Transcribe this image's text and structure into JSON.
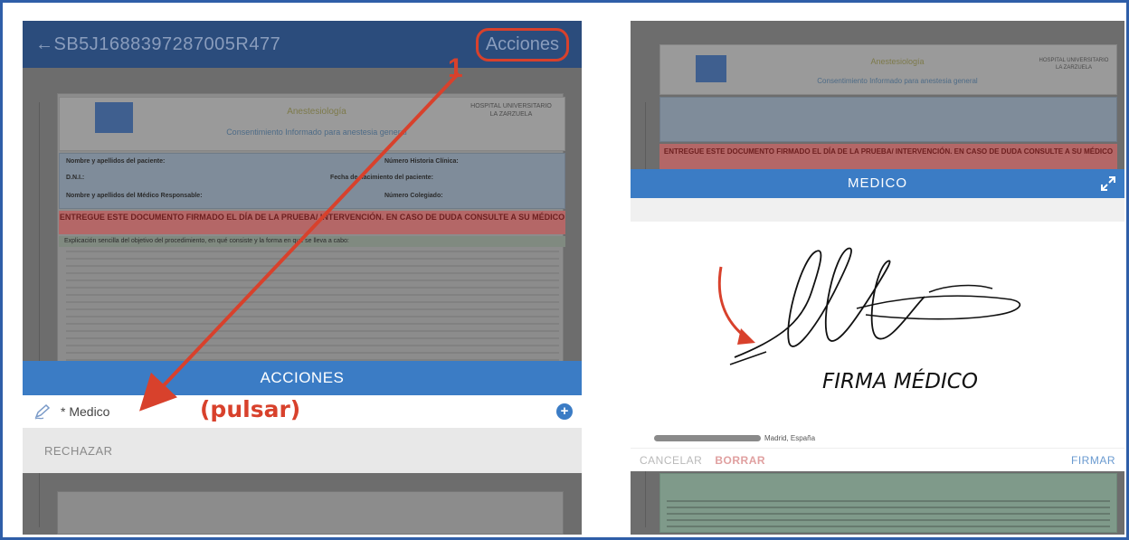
{
  "left": {
    "doc_id": "←SB5J1688397287005R477",
    "acciones_button": "Acciones",
    "step_number": "1",
    "doc_header_title": "Anestesiología",
    "doc_header_sub": "Consentimiento Informado para anestesia general",
    "doc_hospital": "HOSPITAL UNIVERSITARIO LA ZARZUELA",
    "doc_info": {
      "row1_label": "Nombre y apellidos del paciente:",
      "row1_right": "Número Historia Clínica:",
      "row2_label": "D.N.I.:",
      "row2_right": "Fecha de nacimiento del paciente:",
      "row3_label": "Nombre y apellidos del Médico Responsable:",
      "row3_right": "Número Colegiado:"
    },
    "doc_warning": "ENTREGUE ESTE DOCUMENTO FIRMADO EL DÍA DE LA PRUEBA/ INTERVENCIÓN. EN CASO DE DUDA CONSULTE A SU MÉDICO",
    "doc_expl": "Explicación sencilla del objetivo del procedimiento, en qué consiste y la forma en que se lleva a cabo:",
    "sheet_title": "ACCIONES",
    "medico_item": "* Medico",
    "pulsar_note": "(pulsar)",
    "rechazar_item": "RECHAZAR"
  },
  "right": {
    "doc_header_title": "Anestesiología",
    "doc_header_sub": "Consentimiento Informado para anestesia general",
    "doc_hospital": "HOSPITAL UNIVERSITARIO LA ZARZUELA",
    "doc_warning": "ENTREGUE ESTE DOCUMENTO FIRMADO EL DÍA DE LA PRUEBA/ INTERVENCIÓN. EN CASO DE DUDA CONSULTE A SU MÉDICO",
    "dialog_title": "MEDICO",
    "signature_caption": "FIRMA MÉDICO",
    "location_text": "Madrid, España",
    "cancel_button": "CANCELAR",
    "clear_button": "BORRAR",
    "sign_button": "FIRMAR"
  },
  "colors": {
    "frame_border": "#2f5ea8",
    "top_bar": "#2b4c7c",
    "sheet_header": "#3b7cc5",
    "annotation_red": "#d8412c"
  },
  "icons": {
    "pen": "pen-icon",
    "plus": "plus-circle-icon",
    "expand": "expand-icon",
    "location": "location-pin-icon"
  }
}
